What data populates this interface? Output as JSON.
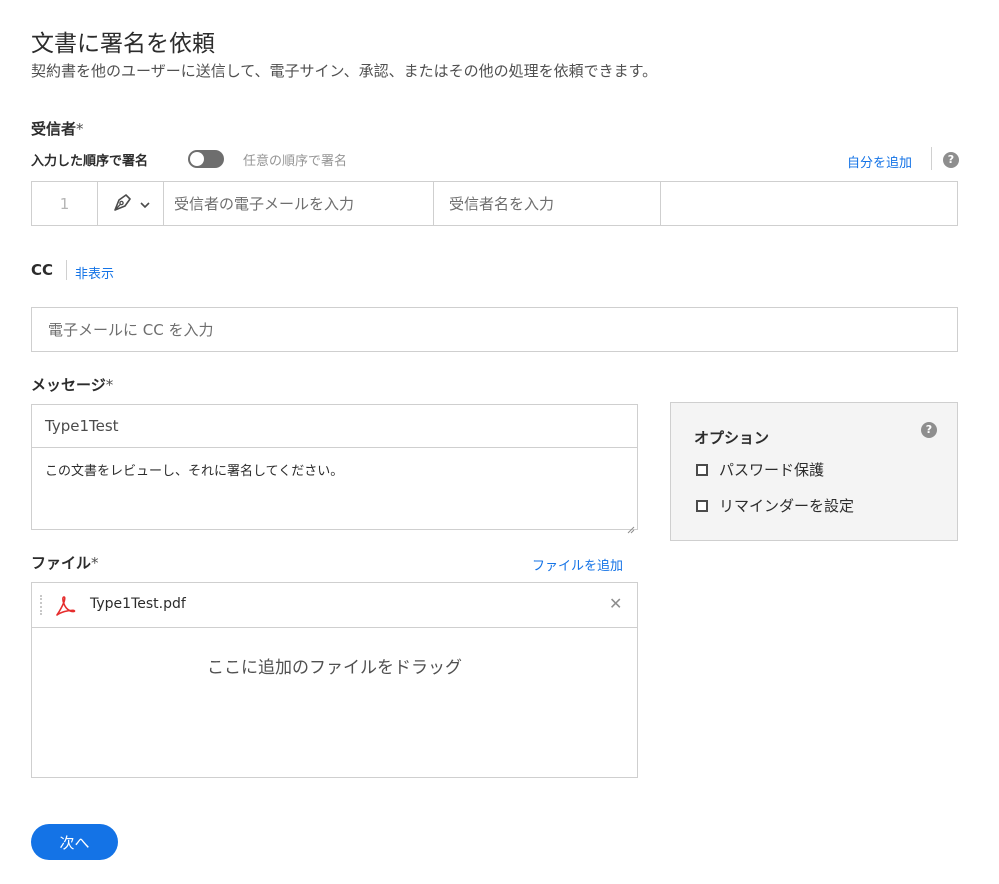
{
  "page": {
    "title": "文書に署名を依頼",
    "subtitle": "契約書を他のユーザーに送信して、電子サイン、承認、またはその他の処理を依頼できます。"
  },
  "recipients": {
    "label": "受信者",
    "required_mark": "*",
    "order_label": "入力した順序で署名",
    "toggle_state": "off",
    "any_order_label": "任意の順序で署名",
    "add_self_link": "自分を追加",
    "help_icon": "help-icon",
    "row": {
      "number": "1",
      "role_icon": "pen-nib-icon",
      "email_placeholder": "受信者の電子メールを入力",
      "name_placeholder": "受信者名を入力"
    }
  },
  "cc": {
    "label": "CC",
    "hide_link": "非表示",
    "placeholder": "電子メールに CC を入力"
  },
  "message": {
    "label": "メッセージ",
    "required_mark": "*",
    "subject_value": "Type1Test",
    "body_value": "この文書をレビューし、それに署名してください。"
  },
  "options": {
    "title": "オプション",
    "help_icon": "help-icon",
    "items": [
      {
        "label": "パスワード保護",
        "checked": false
      },
      {
        "label": "リマインダーを設定",
        "checked": false
      }
    ]
  },
  "files": {
    "label": "ファイル",
    "required_mark": "*",
    "add_link": "ファイルを追加",
    "items": [
      {
        "name": "Type1Test.pdf",
        "icon": "pdf-icon"
      }
    ],
    "drop_text": "ここに追加のファイルをドラッグ"
  },
  "actions": {
    "next_label": "次へ"
  },
  "colors": {
    "accent": "#1473e6",
    "pdf_red": "#e62d2d",
    "toggle_off": "#6e6e6e"
  }
}
